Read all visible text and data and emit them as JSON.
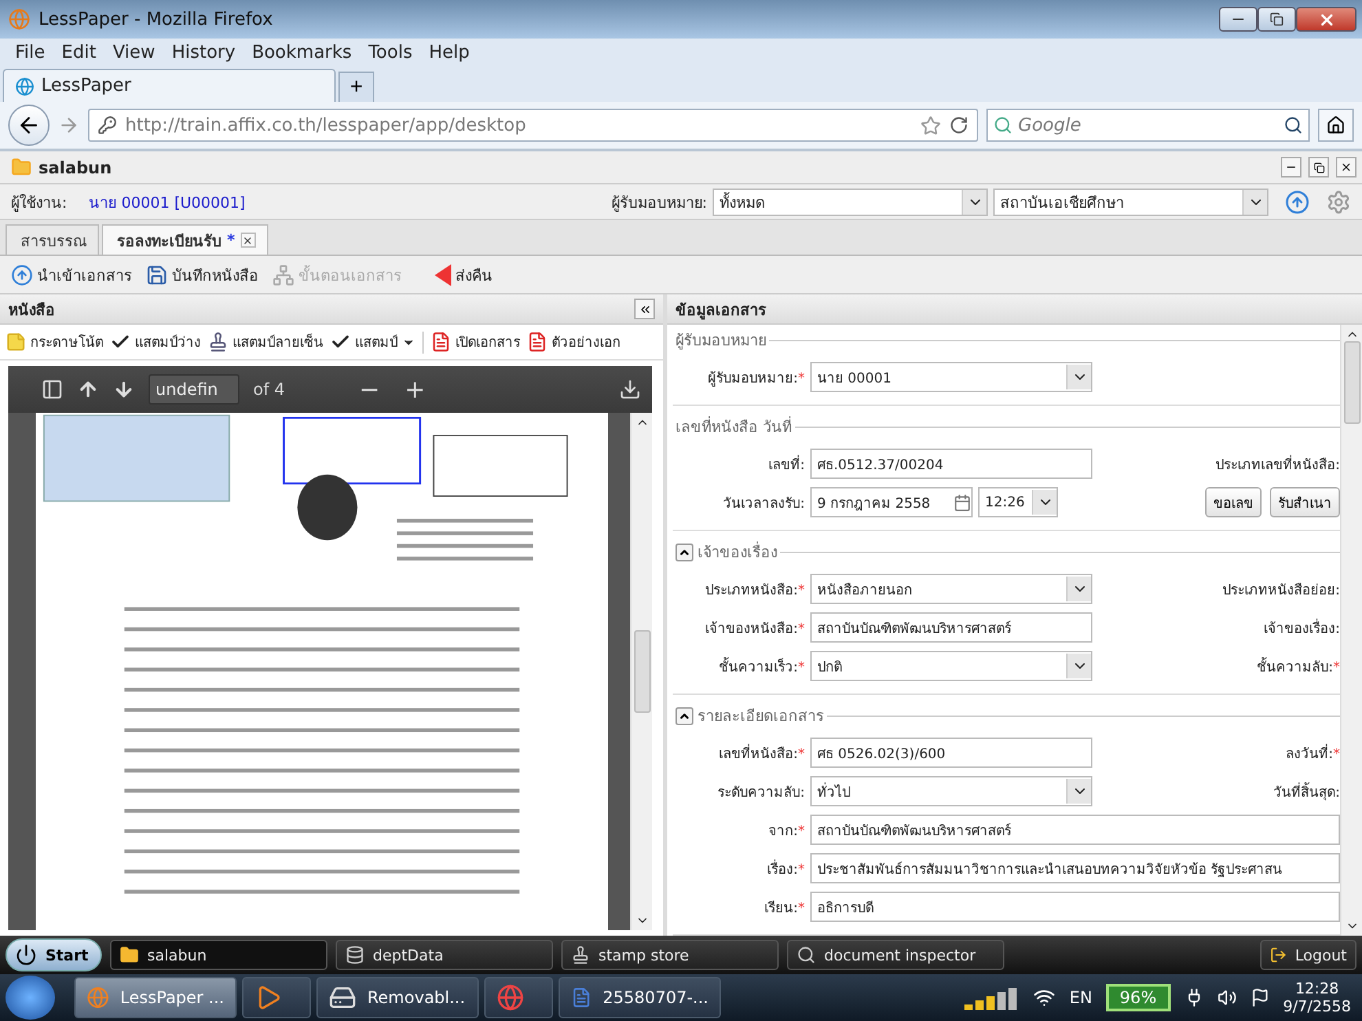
{
  "browser": {
    "title": "LessPaper - Mozilla Firefox",
    "menu": [
      "File",
      "Edit",
      "View",
      "History",
      "Bookmarks",
      "Tools",
      "Help"
    ],
    "tabs": [
      {
        "label": "LessPaper",
        "selected": true
      }
    ],
    "new_tab": "+",
    "url": "http://train.affix.co.th/lesspaper/app/desktop",
    "search_placeholder": "Google"
  },
  "app": {
    "title": "salabun",
    "user_label": "ผู้ใช้งาน:",
    "user": "นาย 00001 [U00001]",
    "assignee_label": "ผู้รับมอบหมาย:",
    "assignee_filter": "ทั้งหมด",
    "organization": "สถาบันเอเชียศึกษา"
  },
  "tabs": [
    {
      "label": "สารบรรณ",
      "selected": false
    },
    {
      "label": "รอลงทะเบียนรับ",
      "selected": true,
      "modified_mark": "*",
      "closable": true
    }
  ],
  "toolbar": [
    {
      "label": "นำเข้าเอกสาร",
      "disabled": false
    },
    {
      "label": "บันทึกหนังสือ",
      "disabled": false
    },
    {
      "label": "ขั้นตอนเอกสาร",
      "disabled": true
    },
    {
      "label": "ส่งคืน",
      "disabled": false
    }
  ],
  "document_panel": {
    "title": "หนังสือ",
    "toolbar": [
      {
        "label": "กระดาษโน้ต",
        "menu": false
      },
      {
        "label": "แสตมป์ว่าง",
        "menu": false
      },
      {
        "label": "แสตมป์ลายเซ็น",
        "menu": false
      },
      {
        "label": "แสตมป์",
        "menu": true
      },
      {
        "label": "เปิดเอกสาร",
        "menu": false
      },
      {
        "label": "ตัวอย่างเอก",
        "menu": false
      }
    ],
    "viewer": {
      "page": "undefin",
      "page_count": "of 4",
      "zoom_out": "−",
      "zoom_in": "+"
    }
  },
  "info_panel": {
    "title": "ข้อมูลเอกสาร",
    "sections": [
      {
        "legend": "ผู้รับมอบหมาย",
        "collapsible": false,
        "rows": [
          {
            "label": "ผู้รับมอบหมาย:",
            "required_mark": "*",
            "kind": "select",
            "value": "นาย 00001"
          }
        ]
      },
      {
        "legend": "เลขที่หนังสือ วันที่",
        "collapsible": false,
        "rows": [
          {
            "label": "เลขที่:",
            "kind": "text",
            "value": "ศธ.0512.37/00204",
            "side_label": "ประเภทเลขที่หนังสือ:"
          },
          {
            "label": "วันเวลาลงรับ:",
            "kind": "datetime",
            "value": "9 กรกฎาคม 2558",
            "time": "12:26",
            "buttons": [
              "ขอเลข",
              "รับสำเนา"
            ]
          }
        ]
      },
      {
        "legend": "เจ้าของเรื่อง",
        "collapsible": true,
        "rows": [
          {
            "label": "ประเภทหนังสือ:",
            "required_mark": "*",
            "kind": "select",
            "value": "หนังสือภายนอก",
            "side_label": "ประเภทหนังสือย่อย:"
          },
          {
            "label": "เจ้าของหนังสือ:",
            "required_mark": "*",
            "kind": "text",
            "value": "สถาบันบัณฑิตพัฒนบริหารศาสตร์",
            "side_label": "เจ้าของเรื่อง:"
          },
          {
            "label": "ชั้นความเร็ว:",
            "required_mark": "*",
            "kind": "select",
            "value": "ปกติ",
            "side_label": "ชั้นความลับ:",
            "side_required_mark": "*"
          }
        ]
      },
      {
        "legend": "รายละเอียดเอกสาร",
        "collapsible": true,
        "rows": [
          {
            "label": "เลขที่หนังสือ:",
            "required_mark": "*",
            "kind": "text",
            "value": "ศธ 0526.02(3)/600",
            "side_label": "ลงวันที่:",
            "side_required_mark": "*"
          },
          {
            "label": "ระดับความลับ:",
            "kind": "select",
            "value": "ทั่วไป",
            "side_label": "วันที่สิ้นสุด:"
          },
          {
            "label": "จาก:",
            "required_mark": "*",
            "kind": "wide",
            "value": "สถาบันบัณฑิตพัฒนบริหารศาสตร์"
          },
          {
            "label": "เรื่อง:",
            "required_mark": "*",
            "kind": "wide",
            "value": "ประชาสัมพันธ์การสัมมนาวิชาการและนำเสนอบทความวิจัยหัวข้อ รัฐประศาสน"
          },
          {
            "label": "เรียน:",
            "required_mark": "*",
            "kind": "wide",
            "value": "อธิการบดี"
          }
        ]
      }
    ]
  },
  "app_taskbar": {
    "start": "Start",
    "items": [
      {
        "label": "salabun",
        "selected": true
      },
      {
        "label": "deptData",
        "selected": false
      },
      {
        "label": "stamp store",
        "selected": false
      },
      {
        "label": "document inspector",
        "selected": false
      }
    ],
    "logout": "Logout"
  },
  "os_taskbar": {
    "items": [
      {
        "label": "LessPaper ...",
        "selected": true
      },
      {
        "selected": false
      },
      {
        "label": "Removabl...",
        "selected": false
      },
      {
        "selected": false
      },
      {
        "label": "25580707-...",
        "selected": false
      }
    ],
    "language": "EN",
    "battery": "96%",
    "time": "12:28",
    "date": "9/7/2558"
  }
}
